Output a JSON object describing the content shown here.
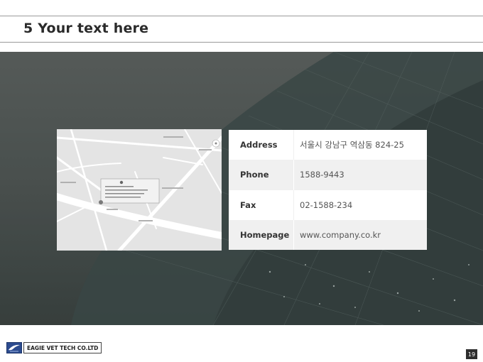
{
  "slide": {
    "title": "5 Your text here",
    "page_number": "19"
  },
  "logo": {
    "text": "EAGIE VET TECH CO.LTD"
  },
  "contact": [
    {
      "label": "Address",
      "value": "서울시 강남구 역삼동 824-25"
    },
    {
      "label": "Phone",
      "value": "1588-9443"
    },
    {
      "label": "Fax",
      "value": "02-1588-234"
    },
    {
      "label": "Homepage",
      "value": "www.company.co.kr"
    }
  ],
  "colors": {
    "title_text": "#2a2a2a",
    "banner_dark": "#3a4240",
    "table_shade": "#f0f0f0",
    "logo_blue": "#2c4b8f"
  }
}
